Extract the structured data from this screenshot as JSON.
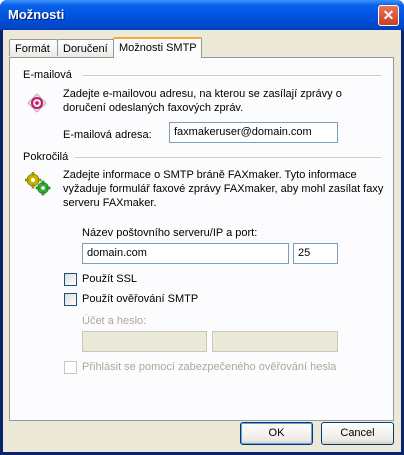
{
  "window": {
    "title": "Možnosti",
    "close_label": "✕"
  },
  "tabs": [
    {
      "label": "Formát"
    },
    {
      "label": "Doručení"
    },
    {
      "label": "Možnosti SMTP"
    }
  ],
  "email_section": {
    "heading": "E-mailová",
    "description": "Zadejte e-mailovou adresu, na kterou se zasílají zprávy o doručení odeslaných faxových zpráv.",
    "field_label": "E-mailová adresa:",
    "field_value": "faxmakeruser@domain.com"
  },
  "advanced_section": {
    "heading": "Pokročilá",
    "description": "Zadejte informace o SMTP bráně FAXmaker. Tyto informace vyžaduje formulář faxové zprávy FAXmaker, aby mohl zasílat faxy serveru FAXmaker.",
    "server_label": "Název poštovního serveru/IP a port:",
    "server_value": "domain.com",
    "port_value": "25",
    "use_ssl": "Použít SSL",
    "use_smtp_auth": "Použít ověřování SMTP",
    "account_label": "Účet a heslo:",
    "secure_login": "Přihlásit se pomocí zabezpečeného ověřování hesla"
  },
  "buttons": {
    "ok": "OK",
    "cancel": "Cancel"
  }
}
